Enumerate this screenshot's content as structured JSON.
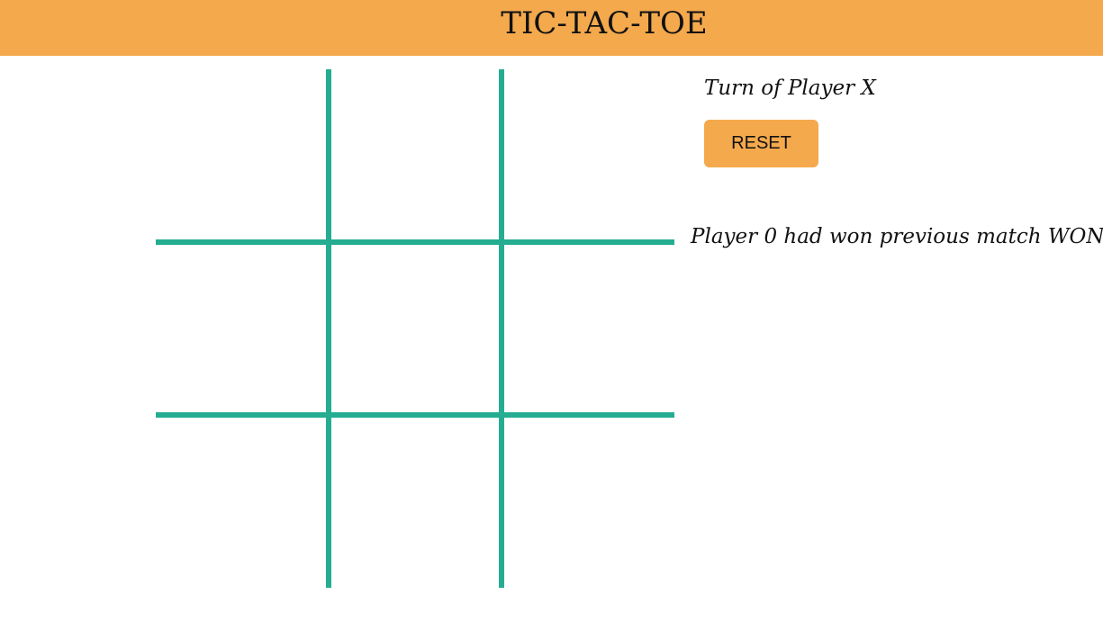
{
  "header": {
    "title": "TIC-TAC-TOE"
  },
  "colors": {
    "accent": "#f4a94d",
    "grid": "#24ad91",
    "text": "#111111",
    "background": "#ffffff"
  },
  "game": {
    "turn_text": "Turn of Player X",
    "reset_label": "RESET",
    "status_message": "Player 0 had won previous match WON",
    "board": [
      "",
      "",
      "",
      "",
      "",
      "",
      "",
      "",
      ""
    ]
  }
}
